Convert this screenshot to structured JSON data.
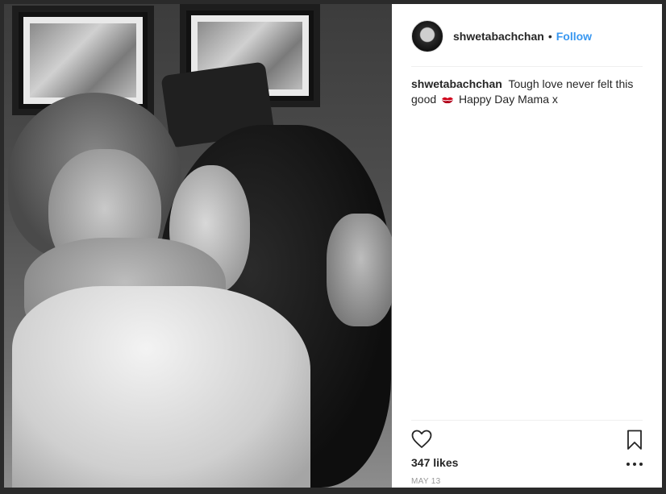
{
  "post": {
    "username": "shwetabachchan",
    "separator": "•",
    "follow_label": "Follow",
    "caption_text_before_emoji": "Tough love never felt this good",
    "caption_text_after_emoji": "Happy Day Mama x",
    "caption_emoji": "kiss-mark-icon",
    "likes": "347 likes",
    "date": "MAY 13"
  },
  "colors": {
    "follow_link": "#3897f0",
    "text": "#262626",
    "muted": "#999999",
    "emoji": "#d0021b"
  }
}
